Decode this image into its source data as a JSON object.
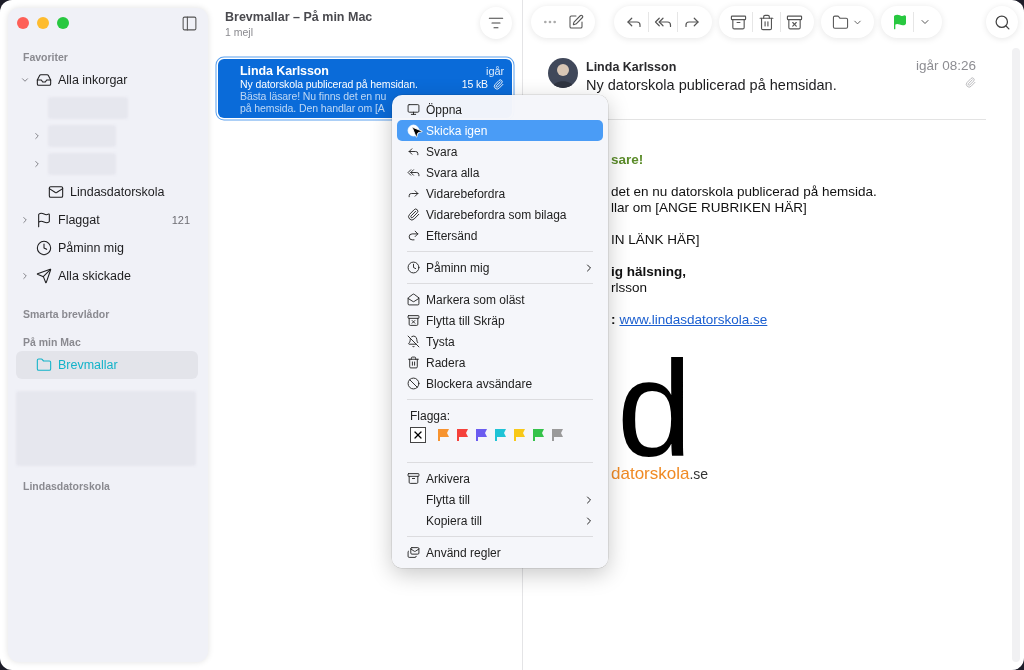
{
  "sidebar": {
    "items": [
      {
        "kind": "heading",
        "label": "Favoriter"
      },
      {
        "kind": "mailbox",
        "label": "Alla inkorgar",
        "expanded": true,
        "selected": false,
        "children": [
          {
            "kind": "redacted"
          },
          {
            "kind": "redacted",
            "expanded": false
          },
          {
            "kind": "redacted",
            "expanded": false
          },
          {
            "kind": "mailbox",
            "label": "Lindasdatorskola",
            "selected": false
          }
        ]
      },
      {
        "kind": "mailbox",
        "label": "Flaggat",
        "expanded": false,
        "count": "121",
        "selected": false
      },
      {
        "kind": "mailbox",
        "label": "Påminn mig",
        "selected": false
      },
      {
        "kind": "mailbox",
        "label": "Alla skickade",
        "expanded": false,
        "selected": false
      },
      {
        "kind": "heading",
        "label": "Smarta brevlådor"
      },
      {
        "kind": "heading",
        "label": "På min Mac"
      },
      {
        "kind": "mailbox",
        "label": "Brevmallar",
        "selected": true
      },
      {
        "kind": "redacted_block"
      },
      {
        "kind": "heading",
        "label": "Lindasdatorskola"
      }
    ]
  },
  "message_list": {
    "title": "Brevmallar – På min Mac",
    "subtitle": "1 mejl",
    "messages": [
      {
        "sender": "Linda Karlsson",
        "date": "igår",
        "subject": "Ny datorskola publicerad på hemsidan.",
        "size": "15 kB",
        "preview": [
          "Bästa läsare! Nu finns det en nu",
          "på hemsida. Den handlar om [A"
        ],
        "selected": true
      }
    ]
  },
  "reader": {
    "sender": "Linda Karlsson",
    "date": "igår 08:26",
    "subject": "Ny datorskola publicerad på hemsidan.",
    "body": [
      [
        {
          "kind": "greeting",
          "text": "sare!"
        }
      ],
      [
        {
          "kind": "text",
          "text": "det en nu datorskola publicerad på hemsida."
        },
        {
          "kind": "text",
          "text": "llar om [ANGE RUBRIKEN HÄR]"
        }
      ],
      [
        {
          "kind": "text",
          "text": "IN LÄNK HÄR]"
        }
      ],
      [
        {
          "kind": "bold",
          "text": "ig hälsning,"
        },
        {
          "kind": "text",
          "text": "rlsson"
        }
      ],
      [
        {
          "kind": "link",
          "text": ":",
          "link": "www.lindasdatorskola.se"
        }
      ]
    ],
    "logo": {
      "mark": "d",
      "name": "datorskola",
      "suffix": ".se"
    }
  },
  "context_menu": {
    "groups": [
      [
        {
          "label": "Öppna",
          "selected": false
        },
        {
          "label": "Skicka igen",
          "selected": true
        },
        {
          "label": "Svara",
          "selected": false
        },
        {
          "label": "Svara alla",
          "selected": false
        },
        {
          "label": "Vidarebefordra",
          "selected": false
        },
        {
          "label": "Vidarebefordra som bilaga",
          "selected": false
        },
        {
          "label": "Eftersänd",
          "selected": false
        }
      ],
      [
        {
          "label": "Påminn mig",
          "selected": false,
          "submenu": true
        }
      ],
      [
        {
          "label": "Markera som oläst",
          "selected": false
        },
        {
          "label": "Flytta till Skräp",
          "selected": false
        },
        {
          "label": "Tysta",
          "selected": false
        },
        {
          "label": "Radera",
          "selected": false
        },
        {
          "label": "Blockera avsändare",
          "selected": false
        }
      ],
      [
        {
          "kind": "flags",
          "label": "Flagga:",
          "flags": [
            {
              "kind": "clear"
            },
            {
              "kind": "flag",
              "color": "#f7932f"
            },
            {
              "kind": "flag",
              "color": "#f5413b"
            },
            {
              "kind": "flag",
              "color": "#6b5cf0"
            },
            {
              "kind": "flag",
              "color": "#1fc3d6"
            },
            {
              "kind": "flag",
              "color": "#f8c818"
            },
            {
              "kind": "flag",
              "color": "#35c24a"
            },
            {
              "kind": "flag",
              "color": "#9a9a9a"
            }
          ]
        }
      ],
      [
        {
          "label": "Arkivera",
          "selected": false
        },
        {
          "label": "Flytta till",
          "selected": false,
          "submenu": true
        },
        {
          "label": "Kopiera till",
          "selected": false,
          "submenu": true
        }
      ],
      [
        {
          "label": "Använd regler",
          "selected": false
        }
      ]
    ]
  }
}
